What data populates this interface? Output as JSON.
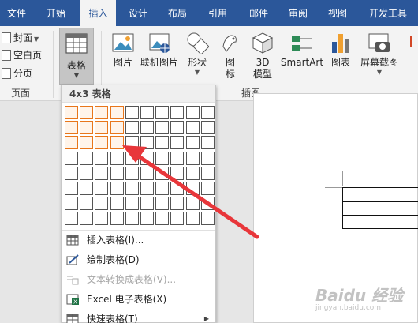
{
  "tabs": [
    {
      "label": "文件",
      "active": false
    },
    {
      "label": "开始",
      "active": false
    },
    {
      "label": "插入",
      "active": true
    },
    {
      "label": "设计",
      "active": false
    },
    {
      "label": "布局",
      "active": false
    },
    {
      "label": "引用",
      "active": false
    },
    {
      "label": "邮件",
      "active": false
    },
    {
      "label": "审阅",
      "active": false
    },
    {
      "label": "视图",
      "active": false
    },
    {
      "label": "开发工具",
      "active": false
    }
  ],
  "pages_group": {
    "cover_label": "封面",
    "blank_label": "空白页",
    "break_label": "分页",
    "group_label": "页面"
  },
  "tables_group": {
    "table_label": "表格"
  },
  "illustrations": {
    "picture": "图片",
    "online_picture": "联机图片",
    "shapes": "形状",
    "icons_l1": "图",
    "icons_l2": "标",
    "model_l1": "3D",
    "model_l2": "模型",
    "smartart": "SmartArt",
    "chart": "图表",
    "screenshot": "屏幕截图",
    "group_label": "插图"
  },
  "dropdown": {
    "header": "4x3 表格",
    "grid": {
      "cols": 10,
      "rows": 8,
      "selected_cols": 4,
      "selected_rows": 3
    },
    "items": [
      {
        "label": "插入表格(I)...",
        "disabled": false,
        "icon": "insert-table-icon"
      },
      {
        "label": "绘制表格(D)",
        "disabled": false,
        "icon": "draw-table-icon"
      },
      {
        "label": "文本转换成表格(V)...",
        "disabled": true,
        "icon": "text-to-table-icon"
      },
      {
        "label": "Excel 电子表格(X)",
        "disabled": false,
        "icon": "excel-icon"
      },
      {
        "label": "快速表格(T)",
        "disabled": false,
        "icon": "quick-tables-icon"
      }
    ]
  },
  "colors": {
    "ribbon_blue": "#2b579a",
    "selection_orange": "#e8761b",
    "arrow_red": "#e8363a"
  },
  "watermark": {
    "text": "Baidu 经验",
    "sub": "jingyan.baidu.com"
  }
}
